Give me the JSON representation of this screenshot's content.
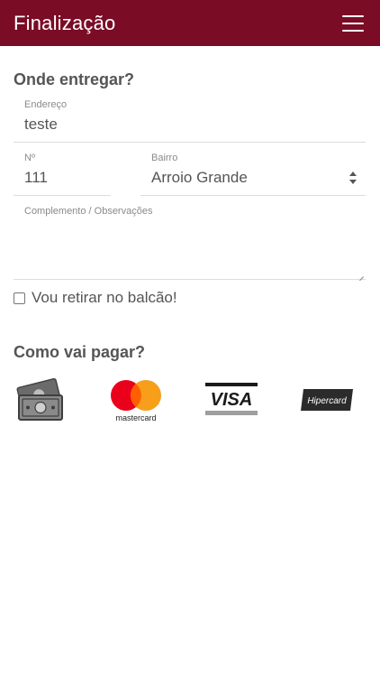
{
  "header": {
    "title": "Finalização",
    "menu_icon": "hamburger-menu-icon"
  },
  "delivery": {
    "section_title": "Onde entregar?",
    "address": {
      "label": "Endereço",
      "value": "teste"
    },
    "number": {
      "label": "Nº",
      "value": "111"
    },
    "neighborhood": {
      "label": "Bairro",
      "value": "Arroio Grande"
    },
    "complement": {
      "label": "Complemento / Observações",
      "value": ""
    },
    "pickup_checkbox": {
      "label": "Vou retirar no balcão!",
      "checked": false
    }
  },
  "payment": {
    "section_title": "Como vai pagar?",
    "methods": [
      {
        "id": "cash",
        "icon": "cash-money-icon"
      },
      {
        "id": "mastercard",
        "icon": "mastercard-logo",
        "text": "mastercard"
      },
      {
        "id": "visa",
        "icon": "visa-logo",
        "text": "VISA"
      },
      {
        "id": "hipercard",
        "icon": "hipercard-logo",
        "text": "Hipercard"
      }
    ]
  },
  "colors": {
    "header_bg": "#7b0c26",
    "mastercard_red": "#eb001b",
    "mastercard_orange": "#f79e1b"
  }
}
